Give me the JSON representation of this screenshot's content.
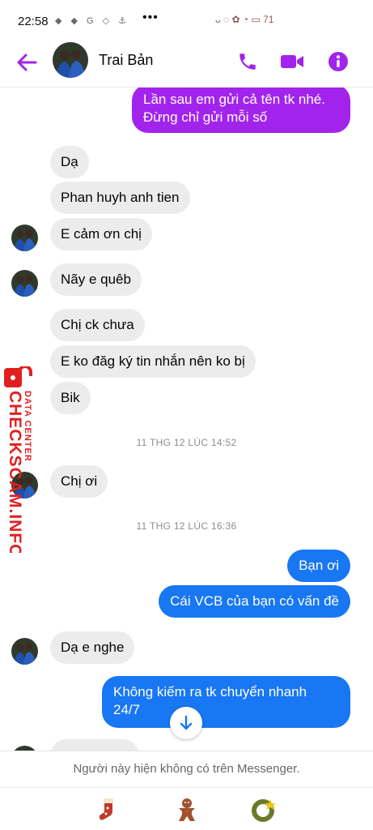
{
  "status_bar": {
    "time": "22:58",
    "left_icons": "◆ ◆ G ◇ ⚓",
    "more": "•••",
    "right_icons": "ᴗ ◌ ✿ ◔ ▭ 71"
  },
  "header": {
    "contact_name": "Trai Bản",
    "accent_color": "#a224ec"
  },
  "messages": [
    {
      "side": "out",
      "style": "purple",
      "text": "Lần sau em gửi cả tên tk nhé.\nĐừng chỉ gửi mỗi số"
    },
    {
      "side": "in",
      "text": "Dạ"
    },
    {
      "side": "in",
      "text": "Phan huyh anh tien"
    },
    {
      "side": "in",
      "text": "E cảm ơn chị"
    },
    {
      "side": "in",
      "text": "Nãy e quêb"
    },
    {
      "side": "in",
      "text": "Chị ck chưa"
    },
    {
      "side": "in",
      "text": "E ko đăg ký tin nhắn nên ko bị"
    },
    {
      "side": "in",
      "text": "Bik"
    },
    {
      "side": "in",
      "text": "Chị ơi"
    },
    {
      "side": "out",
      "style": "blue",
      "text": "Bạn ơi"
    },
    {
      "side": "out",
      "style": "blue",
      "text": "Cái VCB của bạn có vấn đề"
    },
    {
      "side": "in",
      "text": "Dạ e nghe"
    },
    {
      "side": "out",
      "style": "blue",
      "text": "Không kiếm ra tk chuyển nhanh\n24/7"
    }
  ],
  "timestamps": [
    "11 THG 12 LÚC 14:52",
    "11 THG 12 LÚC 16:36"
  ],
  "watermark": {
    "brand": "CHECKSCAM.INFO",
    "subtitle": "DATA CENTER",
    "color": "#e02020"
  },
  "footer": {
    "note": "Người này hiện không có trên Messenger."
  },
  "colors": {
    "blue_bubble": "#1877f2",
    "purple_bubble": "#a224ec",
    "incoming_bubble": "#ececec"
  }
}
